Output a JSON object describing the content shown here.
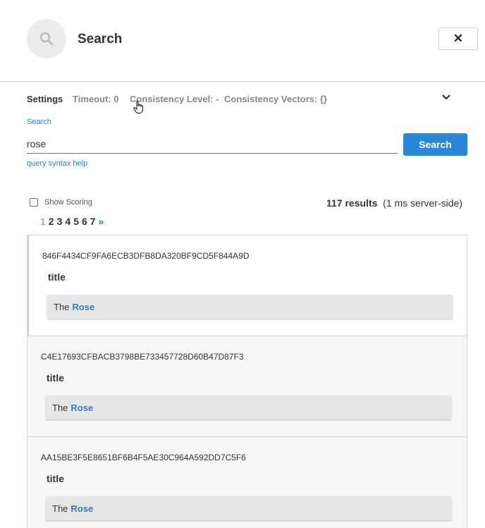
{
  "header": {
    "title": "Search",
    "search_icon": "magnifier-icon",
    "close_icon": "close-icon",
    "close_label": "✕"
  },
  "settings": {
    "label": "Settings",
    "timeout": "Timeout: 0",
    "consistency_level": "Consistency Level: -",
    "consistency_vectors": "Consistency Vectors: {}",
    "expand_icon": "chevron-down-icon"
  },
  "search": {
    "label": "Search",
    "value": "rose",
    "button_label": "Search",
    "syntax_help": "query syntax help"
  },
  "options": {
    "show_scoring_label": "Show Scoring",
    "show_scoring_checked": false
  },
  "summary": {
    "count": "117 results",
    "timing": "(1 ms server-side)"
  },
  "pagination": {
    "pages": [
      "1",
      "2",
      "3",
      "4",
      "5",
      "6",
      "7"
    ],
    "current": "1",
    "next": "»"
  },
  "results": [
    {
      "id": "846F4434CF9FA6ECB3DFB8DA320BF9CD5F844A9D",
      "field": "title",
      "prefix": "The",
      "highlight": "Rose"
    },
    {
      "id": "C4E17693CFBACB3798BE733457728D60B47D87F3",
      "field": "title",
      "prefix": "The",
      "highlight": "Rose"
    },
    {
      "id": "AA15BE3F5E8651BF6B4F5AE30C964A592DD7C5F6",
      "field": "title",
      "prefix": "The",
      "highlight": "Rose"
    }
  ],
  "colors": {
    "accent": "#2a87d8",
    "link": "#2b7fd1",
    "current_page": "#8bb6e0",
    "snippet_bg": "#e6e6e6"
  }
}
